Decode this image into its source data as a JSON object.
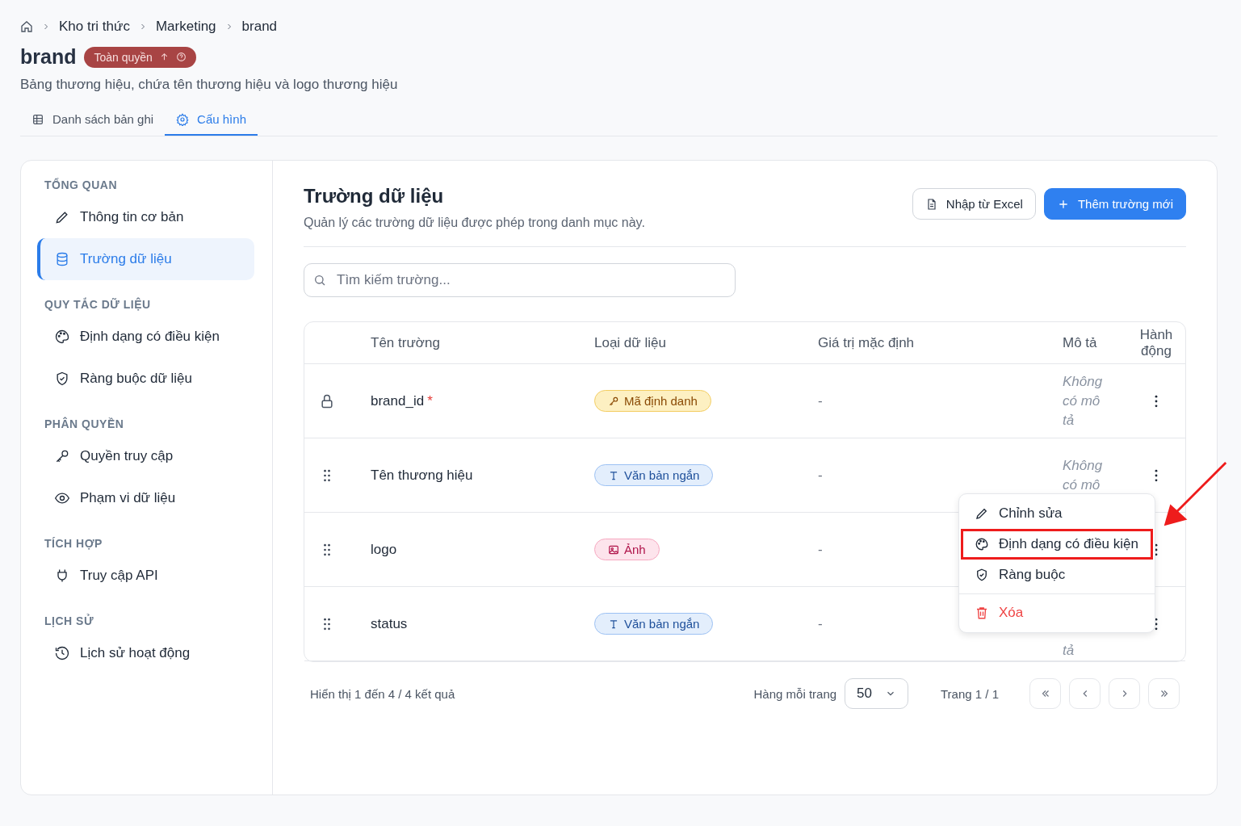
{
  "breadcrumb": [
    "Kho tri thức",
    "Marketing",
    "brand"
  ],
  "title": "brand",
  "permission_badge": "Toàn quyền",
  "description": "Bảng thương hiệu, chứa tên thương hiệu và logo thương hiệu",
  "tabs": [
    {
      "label": "Danh sách bản ghi",
      "kind": "table",
      "selected": false
    },
    {
      "label": "Cấu hình",
      "kind": "gear",
      "selected": true
    }
  ],
  "sidebar": [
    {
      "heading": "TỔNG QUAN",
      "items": [
        {
          "label": "Thông tin cơ bản",
          "kind": "pencil",
          "selected": false
        },
        {
          "label": "Trường dữ liệu",
          "kind": "database",
          "selected": true
        }
      ]
    },
    {
      "heading": "QUY TẮC DỮ LIỆU",
      "items": [
        {
          "label": "Định dạng có điều kiện",
          "kind": "palette",
          "selected": false
        },
        {
          "label": "Ràng buộc dữ liệu",
          "kind": "shield",
          "selected": false
        }
      ]
    },
    {
      "heading": "PHÂN QUYỀN",
      "items": [
        {
          "label": "Quyền truy cập",
          "kind": "key",
          "selected": false
        },
        {
          "label": "Phạm vi dữ liệu",
          "kind": "eye",
          "selected": false
        }
      ]
    },
    {
      "heading": "TÍCH HỢP",
      "items": [
        {
          "label": "Truy cập API",
          "kind": "api",
          "selected": false
        }
      ]
    },
    {
      "heading": "LỊCH SỬ",
      "items": [
        {
          "label": "Lịch sử hoạt động",
          "kind": "history",
          "selected": false
        }
      ]
    }
  ],
  "section": {
    "title": "Trường dữ liệu",
    "subtitle": "Quản lý các trường dữ liệu được phép trong danh mục này.",
    "import_button": "Nhập từ Excel",
    "add_button": "Thêm trường mới"
  },
  "search": {
    "placeholder": "Tìm kiếm trường..."
  },
  "table": {
    "columns": [
      "Tên trường",
      "Loại dữ liệu",
      "Giá trị mặc định",
      "Mô tả",
      "Hành động"
    ],
    "rows": [
      {
        "name": "brand_id",
        "required_mark": "*",
        "locked": true,
        "type": "Mã định danh",
        "kind": "key",
        "default": "-",
        "description": "Không có mô tả"
      },
      {
        "name": "Tên thương hiệu",
        "locked": false,
        "type": "Văn bản ngắn",
        "kind": "text",
        "default": "-",
        "description": "Không có mô"
      },
      {
        "name": "logo",
        "locked": false,
        "type": "Ảnh",
        "kind": "image",
        "default": "-"
      },
      {
        "name": "status",
        "locked": false,
        "type": "Văn bản ngắn",
        "kind": "text",
        "default": "-",
        "description": "tả"
      }
    ]
  },
  "context_menu": [
    {
      "label": "Chỉnh sửa",
      "kind": "pencil",
      "annotated": false
    },
    {
      "label": "Định dạng có điều kiện",
      "kind": "palette",
      "annotated": true
    },
    {
      "label": "Ràng buộc",
      "kind": "shield",
      "annotated": false
    },
    {
      "label": "Xóa",
      "kind": "delete",
      "annotated": false
    }
  ],
  "pagination": {
    "summary": "Hiển thị 1 đến 4 / 4 kết quả",
    "rows_label": "Hàng mỗi trang",
    "rows_value": "50",
    "page": "Trang 1 / 1"
  }
}
